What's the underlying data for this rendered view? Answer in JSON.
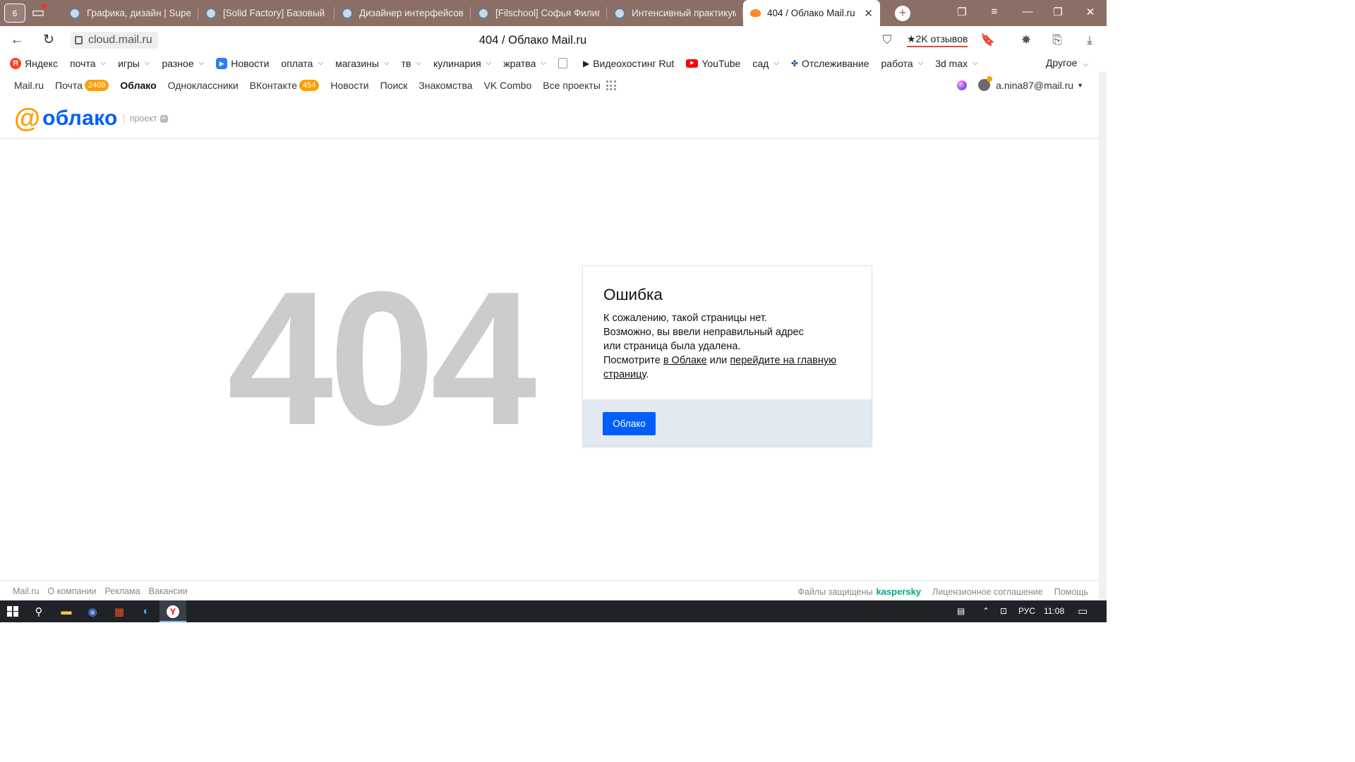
{
  "browser": {
    "tab_counter": "6",
    "tabs": [
      {
        "title": "Графика, дизайн | Supercl"
      },
      {
        "title": "[Solid Factory] Базовый к"
      },
      {
        "title": "Дизайнер интерфейсов"
      },
      {
        "title": "[Filschool] Софья Филипп"
      },
      {
        "title": "Интенсивный практикум"
      },
      {
        "title": "404 / Облако Mail.ru",
        "active": true
      }
    ],
    "url": "cloud.mail.ru",
    "page_title": "404 / Облако Mail.ru",
    "reviews": "★2K отзывов",
    "bookmarks": [
      {
        "label": "Яндекс",
        "icon": "yandex-icon",
        "dropdown": false
      },
      {
        "label": "почта",
        "dropdown": true
      },
      {
        "label": "игры",
        "dropdown": true
      },
      {
        "label": "разное",
        "dropdown": true
      },
      {
        "label": "Новости",
        "icon": "news-icon",
        "dropdown": false
      },
      {
        "label": "оплата",
        "dropdown": true
      },
      {
        "label": "магазины",
        "dropdown": true
      },
      {
        "label": "тв",
        "dropdown": true
      },
      {
        "label": "кулинария",
        "dropdown": true
      },
      {
        "label": "жратва",
        "dropdown": true
      },
      {
        "label": "",
        "icon": "document-icon",
        "dropdown": false
      },
      {
        "label": "Видеохостинг Rut",
        "icon": "play-icon",
        "dropdown": false
      },
      {
        "label": "YouTube",
        "icon": "youtube-icon",
        "dropdown": false
      },
      {
        "label": "сад",
        "dropdown": true
      },
      {
        "label": "Отслеживание",
        "icon": "tracking-icon",
        "dropdown": false
      },
      {
        "label": "работа",
        "dropdown": true
      },
      {
        "label": "3d max",
        "dropdown": true
      }
    ],
    "bookmarks_other": "Другое"
  },
  "portal": {
    "links": [
      {
        "label": "Mail.ru"
      },
      {
        "label": "Почта",
        "badge": "2409"
      },
      {
        "label": "Облако",
        "bold": true
      },
      {
        "label": "Одноклассники"
      },
      {
        "label": "ВКонтакте",
        "badge": "454"
      },
      {
        "label": "Новости"
      },
      {
        "label": "Поиск"
      },
      {
        "label": "Знакомства"
      },
      {
        "label": "VK Combo"
      },
      {
        "label": "Все проекты"
      }
    ],
    "user_email": "a.nina87@mail.ru"
  },
  "brand": {
    "name": "облако",
    "project_label": "проект",
    "vk_mark": "vk"
  },
  "error": {
    "code": "404",
    "title": "Ошибка",
    "line1": "К сожалению, такой страницы нет.",
    "line2": "Возможно, вы ввели неправильный адрес",
    "line3": "или страница была удалена.",
    "line4_prefix": "Посмотрите ",
    "link_cloud": "в Облаке",
    "line4_mid": " или ",
    "link_home": "перейдите на главную страницу",
    "line4_suffix": ".",
    "button": "Облако"
  },
  "footer": {
    "left": [
      "Mail.ru",
      "О компании",
      "Реклама",
      "Вакансии"
    ],
    "protected": "Файлы защищены",
    "kaspersky": "kaspersky",
    "license": "Лицензионное соглашение",
    "help": "Помощь"
  },
  "taskbar": {
    "lang": "РУС",
    "time": "11:08"
  }
}
